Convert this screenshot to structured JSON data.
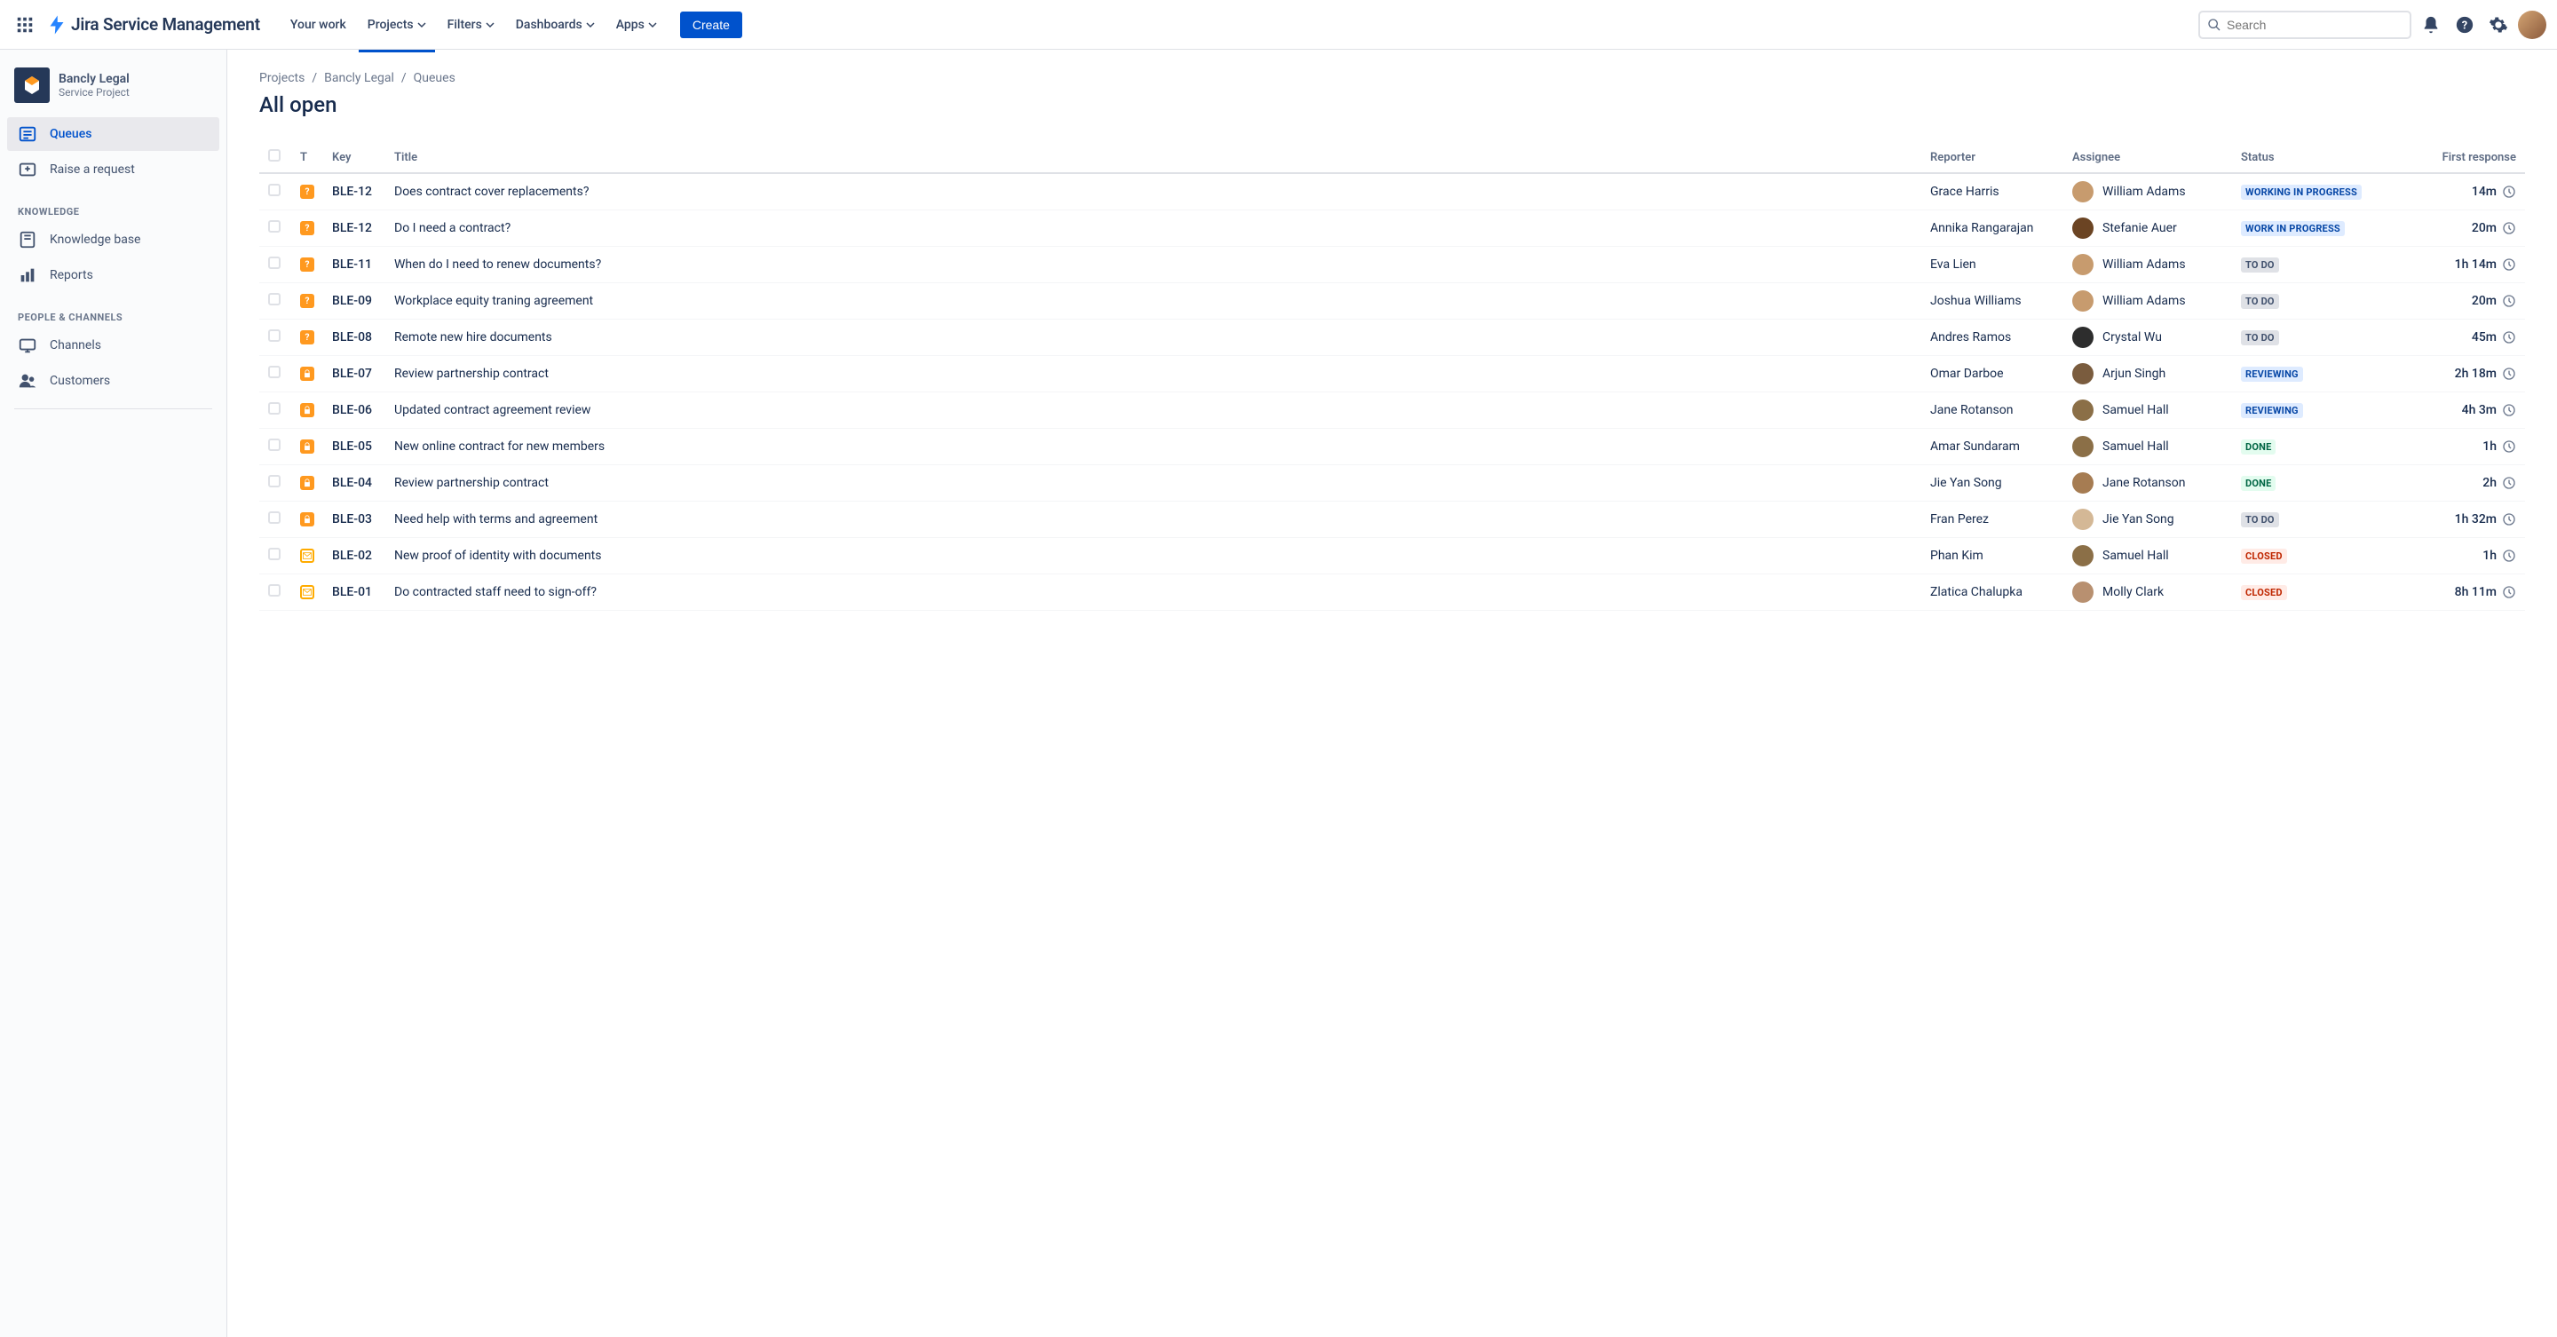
{
  "topnav": {
    "product": "Jira Service Management",
    "items": [
      "Your work",
      "Projects",
      "Filters",
      "Dashboards",
      "Apps"
    ],
    "create": "Create",
    "search_placeholder": "Search"
  },
  "sidebar": {
    "project_name": "Bancly Legal",
    "project_type": "Service Project",
    "main_items": [
      {
        "label": "Queues",
        "icon": "queues",
        "active": true
      },
      {
        "label": "Raise a request",
        "icon": "raise",
        "active": false
      }
    ],
    "section_knowledge": "KNOWLEDGE",
    "knowledge_items": [
      {
        "label": "Knowledge base",
        "icon": "book"
      },
      {
        "label": "Reports",
        "icon": "reports"
      }
    ],
    "section_people": "PEOPLE & CHANNELS",
    "people_items": [
      {
        "label": "Channels",
        "icon": "channels"
      },
      {
        "label": "Customers",
        "icon": "customers"
      }
    ]
  },
  "breadcrumb": [
    "Projects",
    "Bancly Legal",
    "Queues"
  ],
  "page_title": "All open",
  "columns": {
    "type": "T",
    "key": "Key",
    "title": "Title",
    "reporter": "Reporter",
    "assignee": "Assignee",
    "status": "Status",
    "first_response": "First response"
  },
  "rows": [
    {
      "type": "question",
      "key": "BLE-12",
      "title": "Does contract cover replacements?",
      "reporter": "Grace Harris",
      "assignee": "William Adams",
      "avatar": "#c79b6e",
      "status": "WORKING IN PROGRESS",
      "status_class": "inprogress",
      "response": "14m"
    },
    {
      "type": "question",
      "key": "BLE-12",
      "title": "Do I need a contract?",
      "reporter": "Annika Rangarajan",
      "assignee": "Stefanie Auer",
      "avatar": "#6b4423",
      "status": "WORK IN PROGRESS",
      "status_class": "inprogress",
      "response": "20m"
    },
    {
      "type": "question",
      "key": "BLE-11",
      "title": "When do I need to renew documents?",
      "reporter": "Eva Lien",
      "assignee": "William Adams",
      "avatar": "#c79b6e",
      "status": "TO DO",
      "status_class": "todo",
      "response": "1h 14m"
    },
    {
      "type": "question",
      "key": "BLE-09",
      "title": "Workplace equity traning agreement",
      "reporter": "Joshua Williams",
      "assignee": "William Adams",
      "avatar": "#c79b6e",
      "status": "TO DO",
      "status_class": "todo",
      "response": "20m"
    },
    {
      "type": "question",
      "key": "BLE-08",
      "title": "Remote new hire documents",
      "reporter": "Andres Ramos",
      "assignee": "Crystal Wu",
      "avatar": "#2d2d2d",
      "status": "TO DO",
      "status_class": "todo",
      "response": "45m"
    },
    {
      "type": "lock",
      "key": "BLE-07",
      "title": "Review partnership contract",
      "reporter": "Omar Darboe",
      "assignee": "Arjun Singh",
      "avatar": "#7a5c3e",
      "status": "REVIEWING",
      "status_class": "reviewing",
      "response": "2h 18m"
    },
    {
      "type": "lock",
      "key": "BLE-06",
      "title": "Updated contract agreement review",
      "reporter": "Jane Rotanson",
      "assignee": "Samuel Hall",
      "avatar": "#8b6f47",
      "status": "REVIEWING",
      "status_class": "reviewing",
      "response": "4h 3m"
    },
    {
      "type": "lock",
      "key": "BLE-05",
      "title": "New online contract for new members",
      "reporter": "Amar Sundaram",
      "assignee": "Samuel Hall",
      "avatar": "#8b6f47",
      "status": "DONE",
      "status_class": "done",
      "response": "1h"
    },
    {
      "type": "lock",
      "key": "BLE-04",
      "title": "Review partnership contract",
      "reporter": "Jie Yan Song",
      "assignee": "Jane Rotanson",
      "avatar": "#a67c52",
      "status": "DONE",
      "status_class": "done",
      "response": "2h"
    },
    {
      "type": "lock",
      "key": "BLE-03",
      "title": "Need help with terms and agreement",
      "reporter": "Fran Perez",
      "assignee": "Jie Yan Song",
      "avatar": "#d4b896",
      "status": "TO DO",
      "status_class": "todo",
      "response": "1h 32m"
    },
    {
      "type": "mail",
      "key": "BLE-02",
      "title": "New proof of identity with documents",
      "reporter": "Phan Kim",
      "assignee": "Samuel Hall",
      "avatar": "#8b6f47",
      "status": "CLOSED",
      "status_class": "closed",
      "response": "1h"
    },
    {
      "type": "mail",
      "key": "BLE-01",
      "title": "Do contracted staff need to sign-off?",
      "reporter": "Zlatica Chalupka",
      "assignee": "Molly Clark",
      "avatar": "#b89070",
      "status": "CLOSED",
      "status_class": "closed",
      "response": "8h 11m"
    }
  ]
}
